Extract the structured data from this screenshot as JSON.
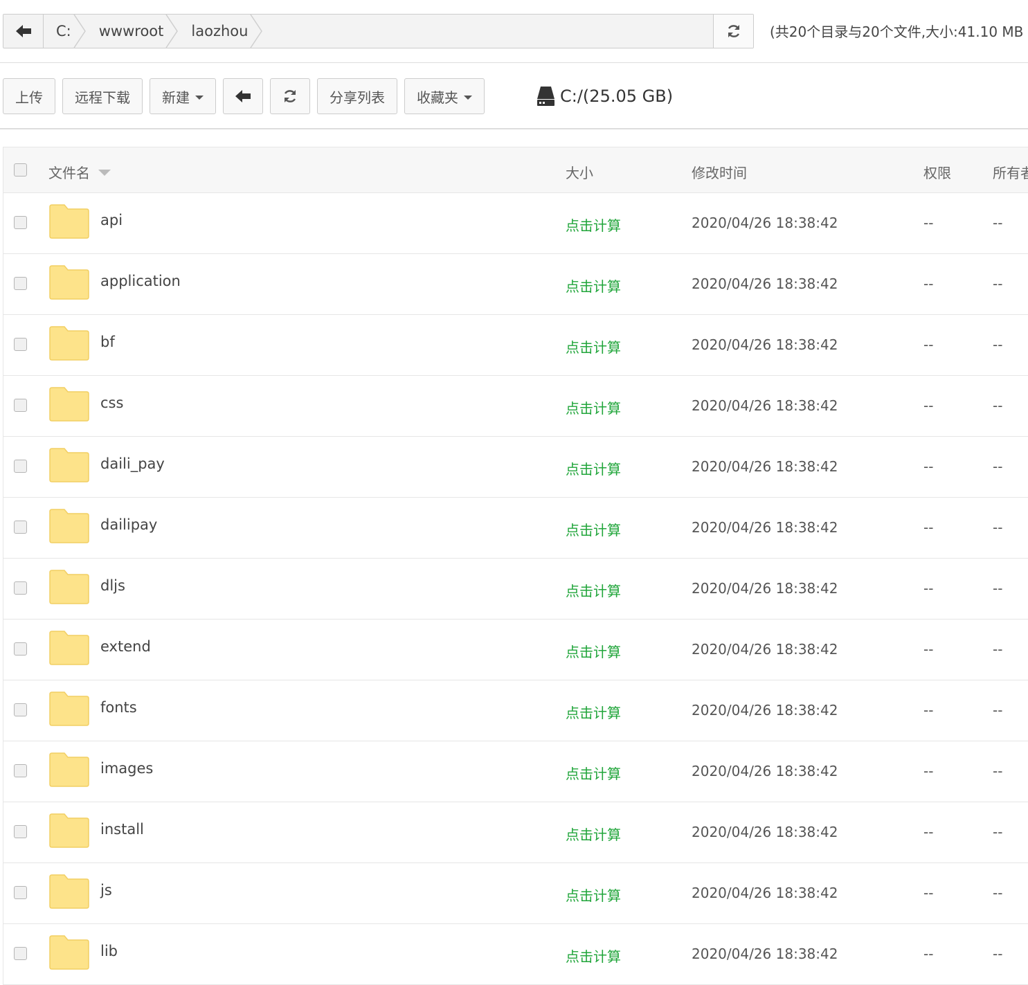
{
  "path_bar": {
    "back_icon": "arrow-left-icon",
    "crumbs": [
      "C:",
      "wwwroot",
      "laozhou"
    ],
    "refresh_icon": "refresh-icon",
    "summary": "(共20个目录与20个文件,大小:41.10 MB"
  },
  "toolbar": {
    "upload_label": "上传",
    "remote_download_label": "远程下载",
    "new_label": "新建",
    "back_icon": "arrow-left-icon",
    "refresh_icon": "refresh-icon",
    "share_list_label": "分享列表",
    "favorites_label": "收藏夹",
    "disk_icon": "hard-drive-icon",
    "disk_label": "C:/(25.05 GB)"
  },
  "table": {
    "headers": {
      "name": "文件名",
      "size": "大小",
      "mtime": "修改时间",
      "permission": "权限",
      "owner": "所有者"
    },
    "rows": [
      {
        "name": "api",
        "size": "点击计算",
        "mtime": "2020/04/26 18:38:42",
        "permission": "--",
        "owner": "--"
      },
      {
        "name": "application",
        "size": "点击计算",
        "mtime": "2020/04/26 18:38:42",
        "permission": "--",
        "owner": "--"
      },
      {
        "name": "bf",
        "size": "点击计算",
        "mtime": "2020/04/26 18:38:42",
        "permission": "--",
        "owner": "--"
      },
      {
        "name": "css",
        "size": "点击计算",
        "mtime": "2020/04/26 18:38:42",
        "permission": "--",
        "owner": "--"
      },
      {
        "name": "daili_pay",
        "size": "点击计算",
        "mtime": "2020/04/26 18:38:42",
        "permission": "--",
        "owner": "--"
      },
      {
        "name": "dailipay",
        "size": "点击计算",
        "mtime": "2020/04/26 18:38:42",
        "permission": "--",
        "owner": "--"
      },
      {
        "name": "dljs",
        "size": "点击计算",
        "mtime": "2020/04/26 18:38:42",
        "permission": "--",
        "owner": "--"
      },
      {
        "name": "extend",
        "size": "点击计算",
        "mtime": "2020/04/26 18:38:42",
        "permission": "--",
        "owner": "--"
      },
      {
        "name": "fonts",
        "size": "点击计算",
        "mtime": "2020/04/26 18:38:42",
        "permission": "--",
        "owner": "--"
      },
      {
        "name": "images",
        "size": "点击计算",
        "mtime": "2020/04/26 18:38:42",
        "permission": "--",
        "owner": "--"
      },
      {
        "name": "install",
        "size": "点击计算",
        "mtime": "2020/04/26 18:38:42",
        "permission": "--",
        "owner": "--"
      },
      {
        "name": "js",
        "size": "点击计算",
        "mtime": "2020/04/26 18:38:42",
        "permission": "--",
        "owner": "--"
      },
      {
        "name": "lib",
        "size": "点击计算",
        "mtime": "2020/04/26 18:38:42",
        "permission": "--",
        "owner": "--"
      }
    ]
  },
  "colors": {
    "size_link": "#20a53a",
    "folder_fill": "#fde38a",
    "folder_stroke": "#f2cf63",
    "border": "#cccccc"
  }
}
